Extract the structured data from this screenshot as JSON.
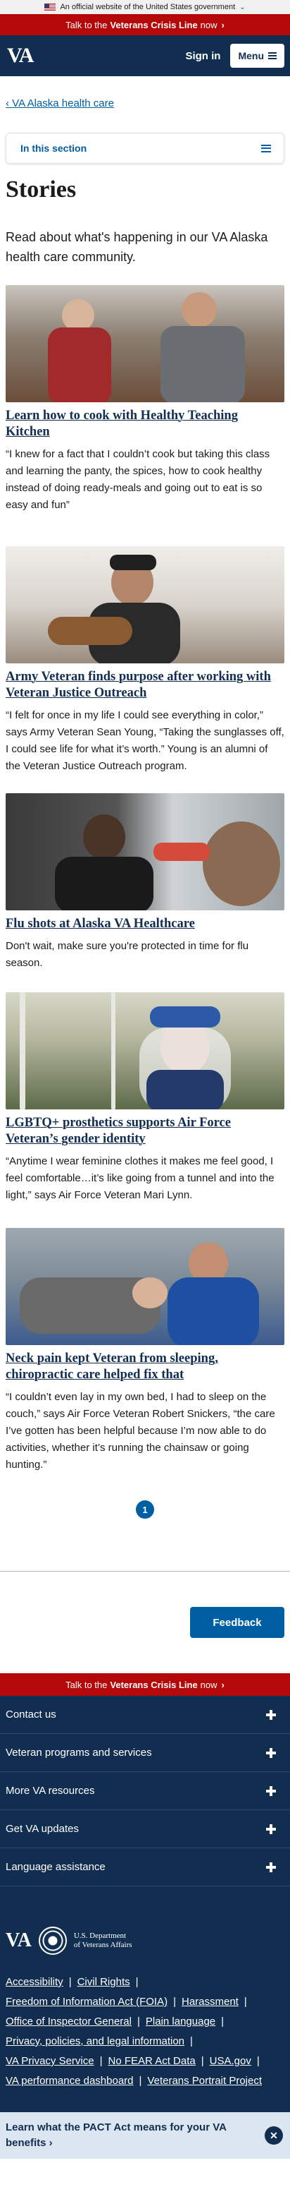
{
  "gov_banner": {
    "text": "An official website of the United States government"
  },
  "crisis_line": {
    "prefix": "Talk to the",
    "highlight": "Veterans Crisis Line",
    "suffix": "now"
  },
  "header": {
    "logo": "VA",
    "sign_in": "Sign in",
    "menu": "Menu"
  },
  "breadcrumb": {
    "label": "VA Alaska health care"
  },
  "in_section": {
    "label": "In this section"
  },
  "page": {
    "title": "Stories",
    "intro": "Read about what's happening in our VA Alaska health care community."
  },
  "stories": [
    {
      "title": "Learn how to cook with Healthy Teaching Kitchen",
      "body": "“I knew for a fact that I couldn’t cook but taking this class and learning the panty, the spices, how to cook healthy instead of doing ready-meals and going out to eat is so easy and fun”"
    },
    {
      "title": "Army Veteran finds purpose after working with Veteran Justice Outreach",
      "body": "“I felt for once in my life I could see everything in color,” says Army Veteran Sean Young, “Taking the sunglasses off, I could see life for what it’s worth.” Young is an alumni of the Veteran Justice Outreach program."
    },
    {
      "title": "Flu shots at Alaska VA Healthcare",
      "body": "Don't wait, make sure you're protected in time for flu season."
    },
    {
      "title": "LGBTQ+ prosthetics supports Air Force Veteran’s gender identity",
      "body": "“Anytime I wear feminine clothes it makes me feel good, I feel comfortable…it’s like going from a tunnel and into the light,” says Air Force Veteran Mari Lynn."
    },
    {
      "title": "Neck pain kept Veteran from sleeping, chiropractic care helped fix that",
      "body": "“I couldn’t even lay in my own bed, I had to sleep on the couch,” says Air Force Veteran Robert Snickers, “the care I’ve gotten has been helpful because I’m now able to do activities, whether it’s running the chainsaw or going hunting.”"
    }
  ],
  "pagination": {
    "current": "1"
  },
  "feedback": {
    "label": "Feedback"
  },
  "footer": {
    "accordions": [
      "Contact us",
      "Veteran programs and services",
      "More VA resources",
      "Get VA updates",
      "Language assistance"
    ],
    "logo": "VA",
    "dept_line1": "U.S. Department",
    "dept_line2": "of Veterans Affairs",
    "links": [
      [
        "Accessibility",
        "Civil Rights"
      ],
      [
        "Freedom of Information Act (FOIA)",
        "Harassment"
      ],
      [
        "Office of Inspector General",
        "Plain language"
      ],
      [
        "Privacy, policies, and legal information"
      ],
      [
        "VA Privacy Service",
        "No FEAR Act Data",
        "USA.gov"
      ],
      [
        "VA performance dashboard",
        "Veterans Portrait Project"
      ]
    ],
    "pact_banner": "Learn what the PACT Act means for your VA benefits"
  }
}
